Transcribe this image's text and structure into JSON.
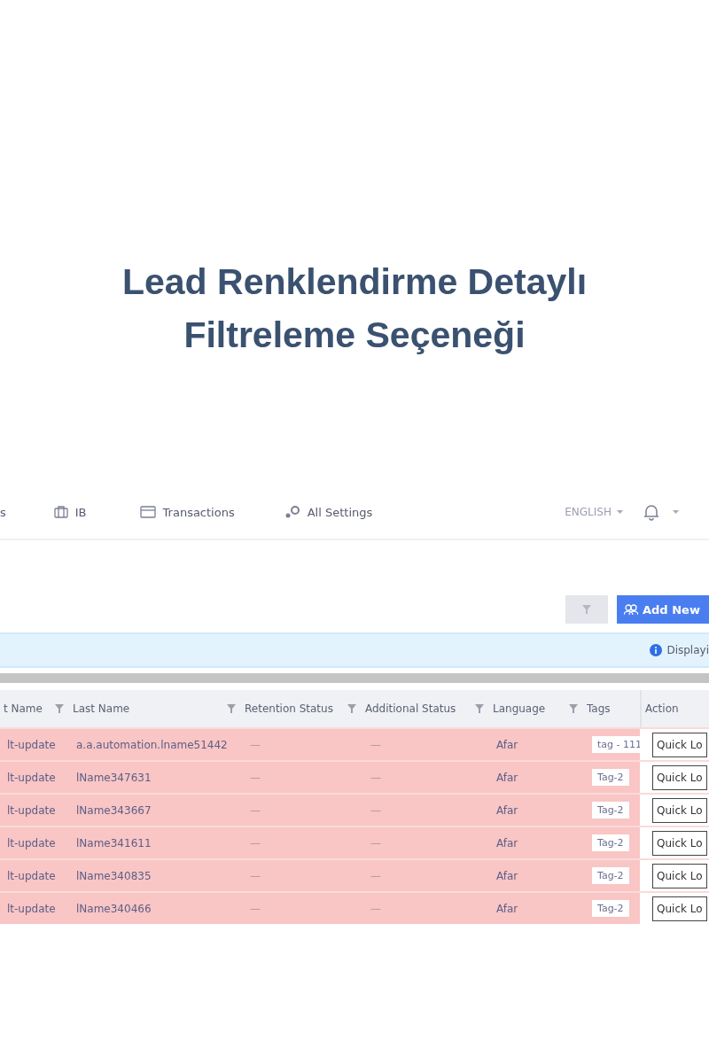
{
  "title": "Lead Renklendirme Detaylı Filtreleme Seçeneği",
  "nav": {
    "items": [
      {
        "label": "s",
        "kind": "text"
      },
      {
        "label": "IB",
        "kind": "icon"
      },
      {
        "label": "Transactions",
        "kind": "icon"
      },
      {
        "label": "All Settings",
        "kind": "icon"
      }
    ],
    "language": "ENGLISH"
  },
  "toolbar": {
    "add_button": "Add New"
  },
  "banner": {
    "text": "Displayi"
  },
  "table": {
    "columns": [
      {
        "label": "t Name",
        "filterable": true
      },
      {
        "label": "Last Name",
        "filterable": true
      },
      {
        "label": "Retention Status",
        "filterable": true
      },
      {
        "label": "Additional Status",
        "filterable": true
      },
      {
        "label": "Language",
        "filterable": true
      },
      {
        "label": "Tags",
        "filterable": false
      },
      {
        "label": "Action",
        "filterable": false
      }
    ],
    "rows": [
      {
        "cells": [
          "lt-update",
          "a.a.automation.lname51442",
          "—",
          "—",
          "Afar",
          "tag - 111",
          "Quick Lo"
        ]
      },
      {
        "cells": [
          "lt-update",
          "lName347631",
          "—",
          "—",
          "Afar",
          "Tag-2",
          "Quick Lo"
        ]
      },
      {
        "cells": [
          "lt-update",
          "lName343667",
          "—",
          "—",
          "Afar",
          "Tag-2",
          "Quick Lo"
        ]
      },
      {
        "cells": [
          "lt-update",
          "lName341611",
          "—",
          "—",
          "Afar",
          "Tag-2",
          "Quick Lo"
        ]
      },
      {
        "cells": [
          "lt-update",
          "lName340835",
          "—",
          "—",
          "Afar",
          "Tag-2",
          "Quick Lo"
        ]
      },
      {
        "cells": [
          "lt-update",
          "lName340466",
          "—",
          "—",
          "Afar",
          "Tag-2",
          "Quick Lo"
        ]
      }
    ]
  }
}
